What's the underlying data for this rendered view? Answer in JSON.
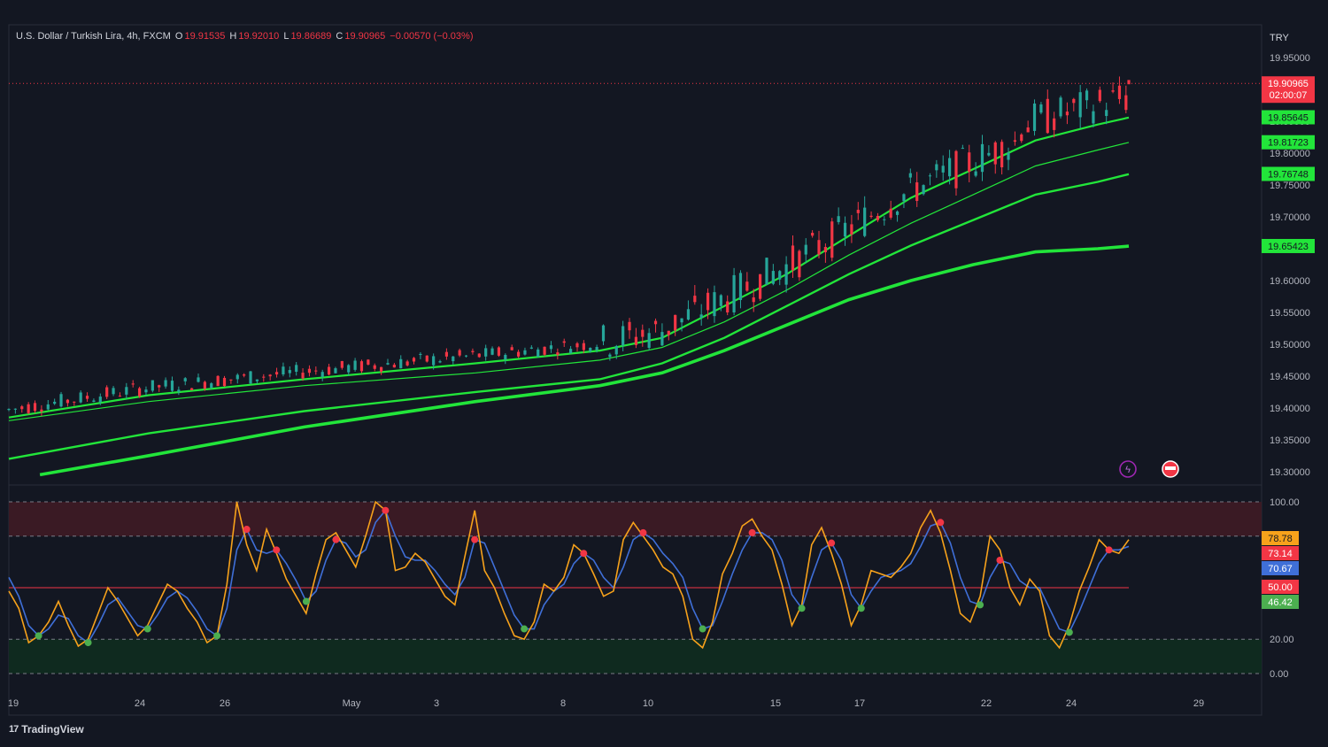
{
  "header": {
    "symbol": "U.S. Dollar / Turkish Lira, 4h, FXCM",
    "o_label": "O",
    "o_value": "19.91535",
    "h_label": "H",
    "h_value": "19.92010",
    "l_label": "L",
    "l_value": "19.86689",
    "c_label": "C",
    "c_value": "19.90965",
    "change": "−0.00570 (−0.03%)"
  },
  "brand": {
    "name": "TradingView",
    "logo_icon": "tradingview-logo-icon"
  },
  "colors": {
    "background": "#131722",
    "up": "#26a69a",
    "down": "#f23645",
    "ma_green": "#22e53a",
    "stoch_k": "#f7a21b",
    "stoch_d": "#3f6fd8",
    "overbought_zone": "#3a1a24",
    "oversold_zone": "#0f2a1f"
  },
  "chart_data": {
    "type": "candlestick",
    "currency": "TRY",
    "y_ticks": [
      "19.95000",
      "19.90000",
      "19.85000",
      "19.80000",
      "19.75000",
      "19.70000",
      "19.65000",
      "19.60000",
      "19.55000",
      "19.50000",
      "19.45000",
      "19.40000",
      "19.35000",
      "19.30000"
    ],
    "ylim": [
      19.29,
      19.96
    ],
    "x_ticks": [
      "19",
      "24",
      "26",
      "May",
      "3",
      "8",
      "10",
      "15",
      "17",
      "22",
      "24",
      "29"
    ],
    "last_price": "19.90965",
    "countdown": "02:00:07",
    "price_line": 19.90965,
    "ma_labels": [
      "19.85645",
      "19.81723",
      "19.76748",
      "19.65423"
    ],
    "moving_averages": [
      {
        "points": [
          [
            0,
            19.385
          ],
          [
            90,
            19.42
          ],
          [
            190,
            19.445
          ],
          [
            300,
            19.47
          ],
          [
            380,
            19.49
          ],
          [
            420,
            19.51
          ],
          [
            460,
            19.56
          ],
          [
            500,
            19.61
          ],
          [
            540,
            19.67
          ],
          [
            580,
            19.73
          ],
          [
            620,
            19.775
          ],
          [
            660,
            19.82
          ],
          [
            700,
            19.845
          ],
          [
            720,
            19.856
          ]
        ]
      },
      {
        "points": [
          [
            0,
            19.38
          ],
          [
            90,
            19.41
          ],
          [
            190,
            19.435
          ],
          [
            300,
            19.455
          ],
          [
            380,
            19.475
          ],
          [
            420,
            19.495
          ],
          [
            460,
            19.535
          ],
          [
            500,
            19.585
          ],
          [
            540,
            19.64
          ],
          [
            580,
            19.69
          ],
          [
            620,
            19.735
          ],
          [
            660,
            19.78
          ],
          [
            700,
            19.805
          ],
          [
            720,
            19.817
          ]
        ]
      },
      {
        "points": [
          [
            0,
            19.32
          ],
          [
            90,
            19.36
          ],
          [
            190,
            19.395
          ],
          [
            300,
            19.425
          ],
          [
            380,
            19.445
          ],
          [
            420,
            19.47
          ],
          [
            460,
            19.51
          ],
          [
            500,
            19.56
          ],
          [
            540,
            19.61
          ],
          [
            580,
            19.655
          ],
          [
            620,
            19.695
          ],
          [
            660,
            19.735
          ],
          [
            700,
            19.755
          ],
          [
            720,
            19.767
          ]
        ]
      },
      {
        "points": [
          [
            20,
            19.295
          ],
          [
            90,
            19.325
          ],
          [
            190,
            19.37
          ],
          [
            300,
            19.41
          ],
          [
            380,
            19.435
          ],
          [
            420,
            19.455
          ],
          [
            460,
            19.49
          ],
          [
            500,
            19.53
          ],
          [
            540,
            19.57
          ],
          [
            580,
            19.6
          ],
          [
            620,
            19.625
          ],
          [
            660,
            19.645
          ],
          [
            700,
            19.65
          ],
          [
            720,
            19.654
          ]
        ]
      }
    ],
    "oscillator": {
      "y_ticks": [
        "100.00",
        "20.00",
        "0.00"
      ],
      "levels": [
        80,
        50,
        20
      ],
      "ylim": [
        0,
        100
      ],
      "labels": [
        "78.78",
        "73.14",
        "70.67",
        "50.00",
        "46.42"
      ],
      "k": [
        48,
        38,
        18,
        22,
        30,
        42,
        28,
        16,
        20,
        35,
        50,
        42,
        32,
        22,
        28,
        40,
        52,
        48,
        38,
        30,
        18,
        22,
        52,
        100,
        75,
        60,
        84,
        70,
        55,
        45,
        35,
        58,
        78,
        82,
        72,
        62,
        80,
        100,
        95,
        60,
        62,
        70,
        65,
        55,
        45,
        40,
        68,
        95,
        60,
        50,
        35,
        22,
        20,
        30,
        52,
        48,
        56,
        75,
        70,
        58,
        45,
        48,
        78,
        88,
        80,
        72,
        62,
        58,
        45,
        20,
        15,
        30,
        58,
        70,
        86,
        90,
        80,
        72,
        52,
        28,
        40,
        75,
        85,
        70,
        52,
        28,
        40,
        60,
        58,
        56,
        62,
        70,
        85,
        95,
        82,
        60,
        35,
        30,
        45,
        80,
        72,
        50,
        40,
        55,
        48,
        22,
        15,
        28,
        48,
        62,
        78,
        72,
        70,
        78
      ],
      "d": [
        56,
        45,
        28,
        22,
        26,
        34,
        32,
        22,
        18,
        28,
        40,
        44,
        36,
        28,
        26,
        34,
        44,
        48,
        44,
        36,
        26,
        22,
        38,
        72,
        84,
        72,
        70,
        72,
        64,
        54,
        42,
        48,
        66,
        78,
        76,
        68,
        72,
        88,
        95,
        80,
        68,
        66,
        66,
        60,
        52,
        46,
        56,
        78,
        76,
        62,
        48,
        34,
        26,
        26,
        40,
        48,
        52,
        64,
        70,
        66,
        56,
        50,
        62,
        78,
        82,
        78,
        70,
        64,
        56,
        38,
        26,
        28,
        42,
        58,
        72,
        82,
        82,
        78,
        66,
        46,
        38,
        56,
        72,
        76,
        66,
        46,
        38,
        48,
        56,
        58,
        60,
        64,
        74,
        86,
        88,
        76,
        56,
        42,
        40,
        56,
        66,
        64,
        54,
        50,
        50,
        38,
        26,
        24,
        36,
        50,
        64,
        72,
        72,
        74
      ]
    }
  }
}
